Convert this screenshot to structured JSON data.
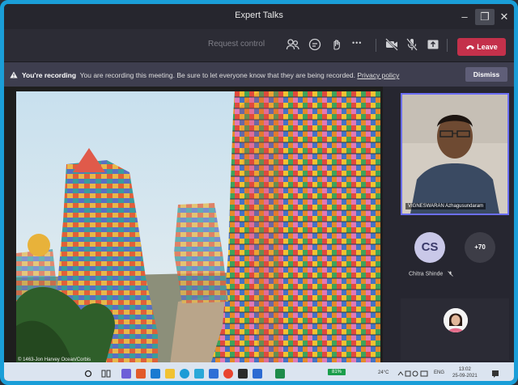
{
  "window": {
    "title": "Expert Talks"
  },
  "window_controls": {
    "minimize": "–",
    "maximize": "❐",
    "close": "✕"
  },
  "toolbar": {
    "request_control": "Request control",
    "leave_label": "Leave",
    "more_label": "•••"
  },
  "banner": {
    "title": "You're recording",
    "message": "You are recording this meeting. Be sure to let everyone know that they are being recorded.",
    "link": "Privacy policy",
    "dismiss": "Dismiss"
  },
  "shared_content": {
    "credit": "© 1463-Jon Harvey Ocean/Corbis"
  },
  "participants": {
    "video_name": "VIGNESWARAN Azhagusundaram",
    "chitra_initials": "CS",
    "chitra_name": "Chitra Shinde",
    "overflow_count": "+70"
  },
  "taskbar": {
    "battery": "81%",
    "weather": "24°C",
    "lang": "ENG",
    "time": "13:02",
    "date": "25-09-2021"
  },
  "colors": {
    "accent": "#1a9ed8",
    "leave": "#c4314b",
    "banner": "#3e3e4f",
    "tile_border": "#6c6ff5"
  }
}
